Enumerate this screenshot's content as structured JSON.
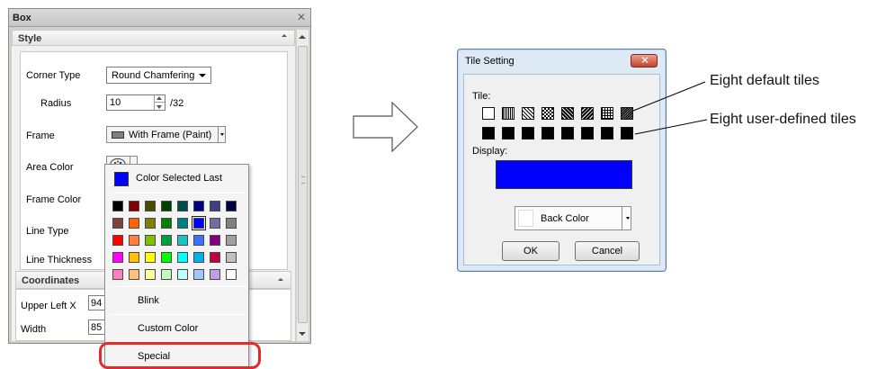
{
  "box_panel": {
    "title": "Box",
    "style_section": "Style",
    "corner_type": {
      "label": "Corner Type",
      "value": "Round Chamfering"
    },
    "radius": {
      "label": "Radius",
      "value": "10",
      "suffix": "/32"
    },
    "frame": {
      "label": "Frame",
      "value": "With Frame (Paint)"
    },
    "area_color": {
      "label": "Area Color"
    },
    "frame_color": {
      "label": "Frame Color"
    },
    "line_type": {
      "label": "Line Type"
    },
    "line_thickness": {
      "label": "Line Thickness"
    },
    "coordinates_section": "Coordinates",
    "upper_left_x": {
      "label": "Upper Left X",
      "value": "94"
    },
    "width": {
      "label": "Width",
      "value": "85"
    }
  },
  "color_dropdown": {
    "color_selected_last": "Color Selected Last",
    "last_color": "#0000ff",
    "palette": [
      [
        "#000000",
        "#800000",
        "#4a4a00",
        "#004000",
        "#004a4a",
        "#000080",
        "#404080",
        "#000040"
      ],
      [
        "#804040",
        "#ff6000",
        "#808000",
        "#008000",
        "#008080",
        "#0000ff",
        "#7070a0",
        "#808080"
      ],
      [
        "#ff0000",
        "#ff8040",
        "#80c000",
        "#00a040",
        "#20c0c0",
        "#4070ff",
        "#800080",
        "#a0a0a0"
      ],
      [
        "#ff00ff",
        "#ffc000",
        "#ffff00",
        "#00ff00",
        "#00ffff",
        "#00b0f0",
        "#c00040",
        "#c0c0c0"
      ],
      [
        "#ff80c0",
        "#ffc080",
        "#ffffa0",
        "#c0ffc0",
        "#c0ffff",
        "#a0c8ff",
        "#c0a0e0",
        "#ffffff"
      ]
    ],
    "selected_cell": [
      1,
      5
    ],
    "blink": "Blink",
    "custom_color": "Custom Color",
    "special": "Special",
    "highlight_color": "#e42a2a"
  },
  "tile_dialog": {
    "title": "Tile Setting",
    "tile_label": "Tile:",
    "display_label": "Display:",
    "display_color": "#0000ff",
    "back_color": "Back Color",
    "ok": "OK",
    "cancel": "Cancel"
  },
  "annotations": {
    "default_tiles": "Eight default tiles",
    "user_tiles": "Eight user-defined tiles"
  }
}
